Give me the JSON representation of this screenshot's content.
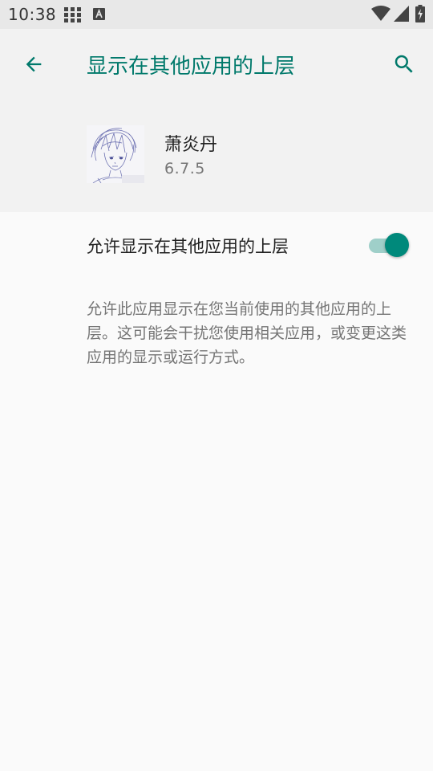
{
  "status_bar": {
    "time": "10:38"
  },
  "app_bar": {
    "title": "显示在其他应用的上层",
    "accent_color": "#00796b"
  },
  "app_info": {
    "name": "萧炎丹",
    "version": "6.7.5"
  },
  "permission": {
    "label": "允许显示在其他应用的上层",
    "enabled": true,
    "description": "允许此应用显示在您当前使用的其他应用的上层。这可能会干扰您使用相关应用，或变更这类应用的显示或运行方式。"
  },
  "icons": {
    "back": "arrow-back-icon",
    "search": "search-icon",
    "status_grid": "grid-icon",
    "status_a": "a-notification-icon",
    "wifi": "wifi-icon",
    "signal": "signal-icon",
    "battery": "battery-charging-icon"
  }
}
